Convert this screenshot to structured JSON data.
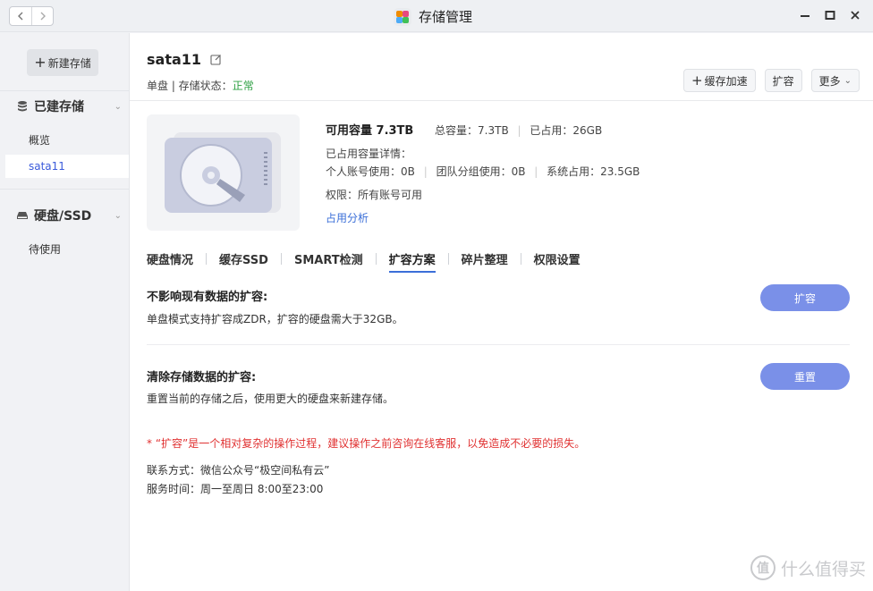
{
  "window": {
    "title": "存储管理",
    "icon": "app-icon"
  },
  "sidebar": {
    "new_storage_label": "新建存储",
    "sections": [
      {
        "label": "已建存储",
        "icon": "database-icon",
        "items": [
          "概览",
          "sata11"
        ]
      },
      {
        "label": "硬盘/SSD",
        "icon": "harddisk-icon",
        "items": [
          "待使用"
        ]
      }
    ],
    "active_item": "sata11"
  },
  "header": {
    "volume_name": "sata11",
    "status_prefix": "单盘 |  存储状态：",
    "status_value": "正常",
    "actions": {
      "cache": "缓存加速",
      "expand": "扩容",
      "more": "更多"
    }
  },
  "info": {
    "available": "可用容量 7.3TB",
    "total": "总容量：7.3TB",
    "used": "已占用：26GB",
    "used_detail_label": "已占用容量详情：",
    "personal": "个人账号使用：0B",
    "team": "团队分组使用：0B",
    "system": "系统占用：23.5GB",
    "permission": "权限：所有账号可用",
    "analysis_link": "占用分析"
  },
  "tabs": [
    "硬盘情况",
    "缓存SSD",
    "SMART检测",
    "扩容方案",
    "碎片整理",
    "权限设置"
  ],
  "active_tab": "扩容方案",
  "expand_options": [
    {
      "title": "不影响现有数据的扩容:",
      "desc": "单盘模式支持扩容成ZDR，扩容的硬盘需大于32GB。",
      "button": "扩容"
    },
    {
      "title": "清除存储数据的扩容:",
      "desc": "重置当前的存储之后，使用更大的硬盘来新建存储。",
      "button": "重置"
    }
  ],
  "warning": "* “扩容”是一个相对复杂的操作过程，建议操作之前咨询在线客服，以免造成不必要的损失。",
  "contact": {
    "method": "联系方式：微信公众号“极空间私有云”",
    "hours": "服务时间：周一至周日 8:00至23:00"
  },
  "watermark": {
    "badge": "值",
    "text": "什么值得买"
  },
  "colors": {
    "accent": "#3b6fd8",
    "button": "#7a90e8",
    "ok": "#2ea043",
    "warning": "#e03131"
  }
}
